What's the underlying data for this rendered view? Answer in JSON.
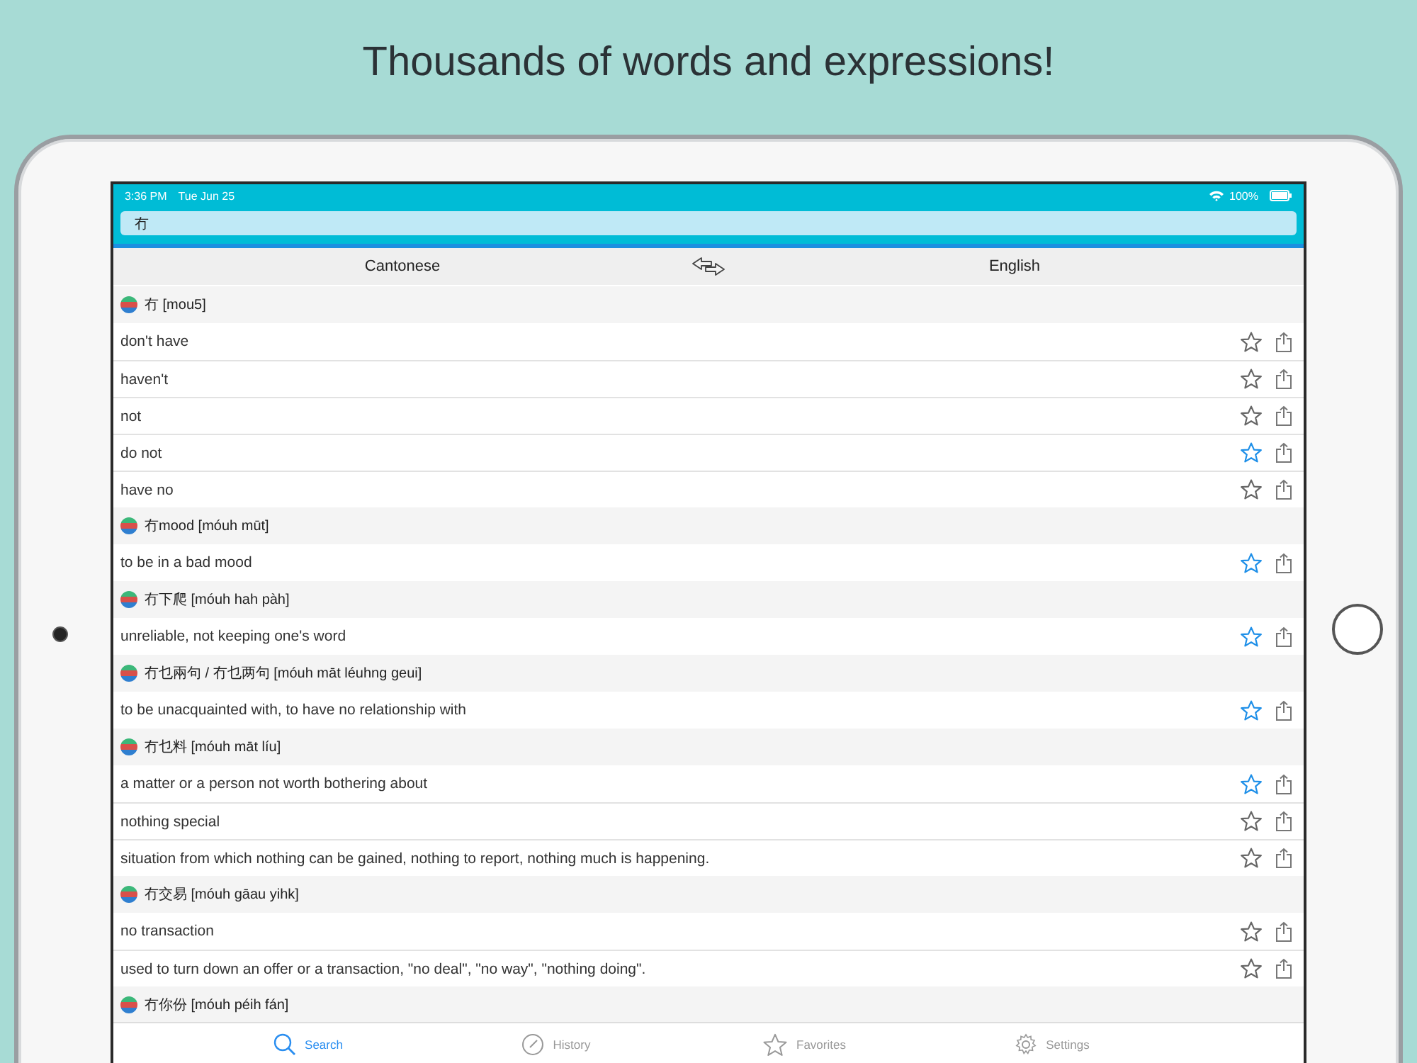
{
  "headline": "Thousands of words and expressions!",
  "status_bar": {
    "time": "3:36 PM",
    "date": "Tue Jun 25",
    "battery": "100%"
  },
  "search": {
    "value": "冇"
  },
  "languages": {
    "from": "Cantonese",
    "to": "English"
  },
  "sections": [
    {
      "heading": "冇 [mou5]",
      "entries": [
        {
          "text": "don't have",
          "favorite": false
        },
        {
          "text": "haven't",
          "favorite": false
        },
        {
          "text": "not",
          "favorite": false
        },
        {
          "text": "do not",
          "favorite": true
        },
        {
          "text": "have no",
          "favorite": false
        }
      ]
    },
    {
      "heading": "冇mood [móuh mūt]",
      "entries": [
        {
          "text": "to be in a bad mood",
          "favorite": true
        }
      ]
    },
    {
      "heading": "冇下爬 [móuh hah pàh]",
      "entries": [
        {
          "text": "unreliable, not keeping one's word",
          "favorite": true
        }
      ]
    },
    {
      "heading": "冇乜兩句 / 冇乜两句 [móuh māt léuhng geui]",
      "entries": [
        {
          "text": "to be unacquainted with, to have no relationship with",
          "favorite": true
        }
      ]
    },
    {
      "heading": "冇乜料 [móuh māt líu]",
      "entries": [
        {
          "text": "a matter or a person not worth bothering about",
          "favorite": true
        },
        {
          "text": "nothing special",
          "favorite": false
        },
        {
          "text": "situation from which nothing can be gained, nothing to report, nothing much is happening.",
          "favorite": false
        }
      ]
    },
    {
      "heading": "冇交易 [móuh gāau yihk]",
      "entries": [
        {
          "text": "no transaction",
          "favorite": false
        },
        {
          "text": "used to turn down an offer or a transaction, \"no deal\", \"no way\", \"nothing doing\".",
          "favorite": false
        }
      ]
    },
    {
      "heading": "冇你份 [móuh péih fán]"
    }
  ],
  "tabs": [
    {
      "label": "Search",
      "kind": "search",
      "selected": true
    },
    {
      "label": "History",
      "kind": "history",
      "selected": false
    },
    {
      "label": "Favorites",
      "kind": "favorites",
      "selected": false
    },
    {
      "label": "Settings",
      "kind": "settings",
      "selected": false
    }
  ]
}
